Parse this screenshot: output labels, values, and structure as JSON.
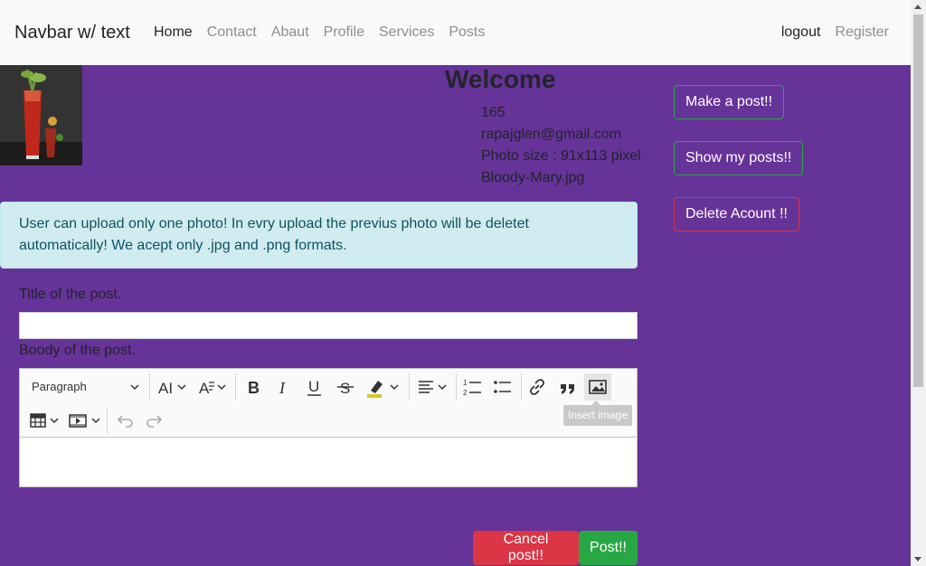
{
  "navbar": {
    "brand": "Navbar w/ text",
    "links": [
      "Home",
      "Contact",
      "Abaut",
      "Profile",
      "Services",
      "Posts"
    ],
    "right_links": [
      "logout",
      "Register"
    ]
  },
  "profile": {
    "welcome": "Welcome",
    "id": "165",
    "email": "rapajglen@gmail.com",
    "photo_size": "Photo size : 91x113 pixel",
    "filename": "Bloody-Mary.jpg"
  },
  "side_buttons": {
    "make_post": "Make a post!!",
    "show_posts": "Show my posts!!",
    "delete_account": "Delete Acount !!"
  },
  "alert": {
    "text": "User can upload only one photo! In evry upload the previus photo will be deletet automatically! We acept only .jpg and .png formats."
  },
  "form": {
    "title_label": "Title of the post.",
    "title_value": "",
    "body_label": "Boody of the post."
  },
  "editor": {
    "heading_select": "Paragraph",
    "tooltip": "Insert image"
  },
  "actions": {
    "cancel": "Cancel post!!",
    "post": "Post!!"
  },
  "colors": {
    "background": "#663399",
    "success": "#28a745",
    "danger": "#dc3545",
    "alert_bg": "#d1ecf1"
  }
}
